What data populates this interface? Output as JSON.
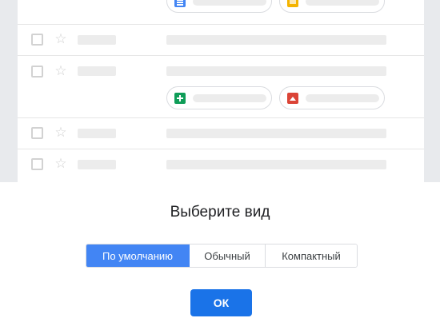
{
  "dialog": {
    "title": "Выберите вид",
    "density_options": [
      {
        "label": "По умолчанию",
        "selected": true
      },
      {
        "label": "Обычный",
        "selected": false
      },
      {
        "label": "Компактный",
        "selected": false
      }
    ],
    "ok_label": "ОК"
  },
  "preview": {
    "star_glyph": "☆",
    "attachment_icons": [
      "docs-icon",
      "slides-icon",
      "sheets-icon",
      "photos-icon"
    ]
  },
  "colors": {
    "accent": "#4285f4",
    "ok_button": "#1a73e8",
    "docs": "#4285f4",
    "slides": "#f4b400",
    "sheets": "#0f9d58",
    "photos": "#db4437"
  }
}
